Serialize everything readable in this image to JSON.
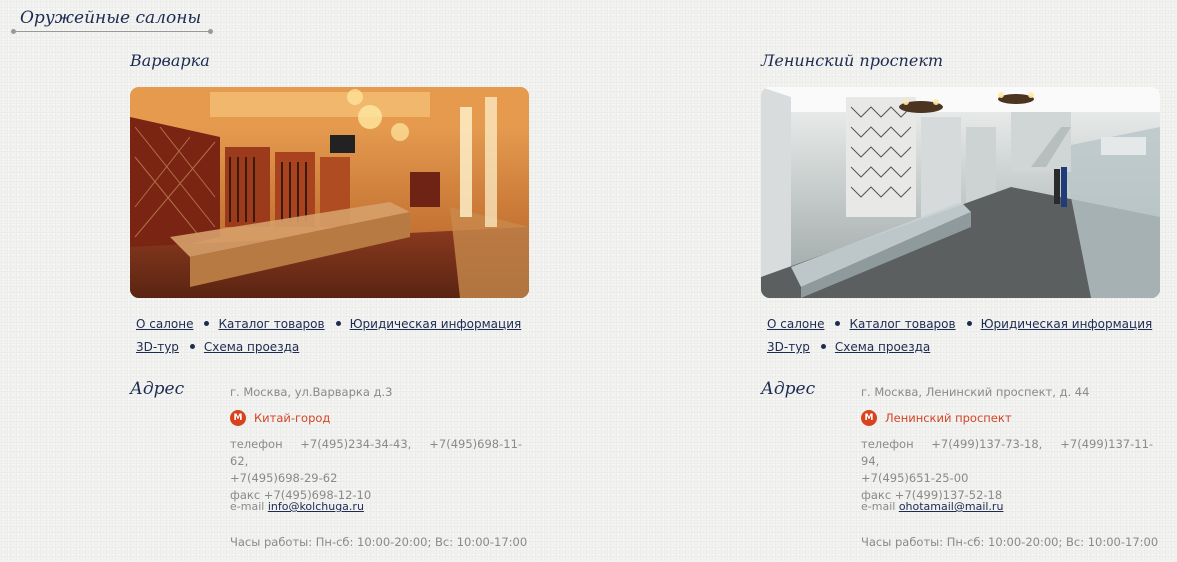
{
  "page_title": "Оружейные салоны",
  "salons": [
    {
      "name": "Варварка",
      "links": [
        "О салоне",
        "Каталог товаров",
        "Юридическая информация",
        "3D-тур",
        "Схема проезда"
      ],
      "address_heading": "Адрес",
      "address": "г. Москва, ул.Варварка д.3",
      "metro_icon": "М",
      "metro": "Китай-город",
      "phone_label": "телефон",
      "phones": [
        "+7(495)234-34-43,",
        "+7(495)698-11-62,",
        "+7(495)698-29-62"
      ],
      "fax": "факс +7(495)698-12-10",
      "email_label": "e-mail",
      "email": "info@kolchuga.ru",
      "hours": "Часы работы: Пн-сб: 10:00-20:00; Вс: 10:00-17:00"
    },
    {
      "name": "Ленинский проспект",
      "links": [
        "О салоне",
        "Каталог товаров",
        "Юридическая информация",
        "3D-тур",
        "Схема проезда"
      ],
      "address_heading": "Адрес",
      "address": "г. Москва, Ленинский проспект, д. 44",
      "metro_icon": "М",
      "metro": "Ленинский проспект",
      "phone_label": "телефон",
      "phones": [
        "+7(499)137-73-18,",
        "+7(499)137-11-94,",
        "+7(495)651-25-00"
      ],
      "fax": "факс +7(499)137-52-18",
      "email_label": "e-mail",
      "email": "ohotamail@mail.ru",
      "hours": "Часы работы: Пн-сб: 10:00-20:00; Вс: 10:00-17:00"
    }
  ],
  "colors": {
    "accent": "#1d2b50",
    "metro": "#d8431e",
    "muted_text": "#8a8a8a"
  }
}
